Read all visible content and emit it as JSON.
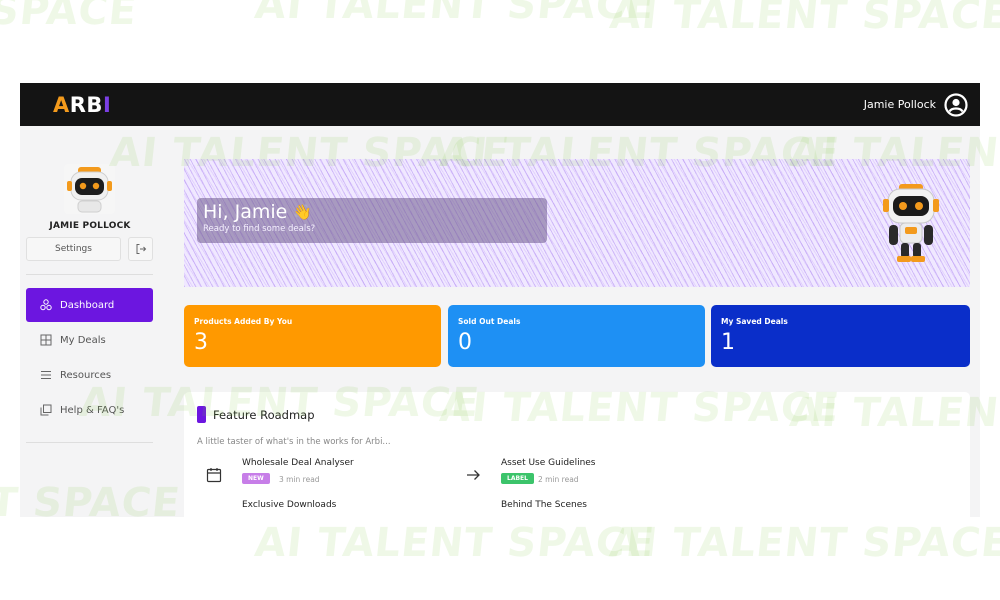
{
  "brand": {
    "logo_a": "A",
    "logo_rb": "RB",
    "logo_i": "I"
  },
  "header": {
    "user_name": "Jamie Pollock"
  },
  "profile": {
    "name": "JAMIE POLLOCK",
    "settings_label": "Settings"
  },
  "nav": [
    {
      "label": "Dashboard",
      "icon": "dashboard-icon",
      "active": true
    },
    {
      "label": "My Deals",
      "icon": "deals-icon",
      "active": false
    },
    {
      "label": "Resources",
      "icon": "resources-icon",
      "active": false
    },
    {
      "label": "Help & FAQ's",
      "icon": "help-icon",
      "active": false
    }
  ],
  "banner": {
    "greeting": "Hi, Jamie",
    "emoji": "👋",
    "subtitle": "Ready to find some deals?"
  },
  "stats": [
    {
      "label": "Products Added By You",
      "value": "3",
      "color": "#ff9900"
    },
    {
      "label": "Sold Out Deals",
      "value": "0",
      "color": "#1e90f4"
    },
    {
      "label": "My Saved Deals",
      "value": "1",
      "color": "#0a2ec9"
    }
  ],
  "roadmap": {
    "title": "Feature Roadmap",
    "subtitle": "A little taster of what's in the works for Arbi...",
    "items": [
      {
        "title": "Wholesale Deal Analyser",
        "badge": "NEW",
        "badge_color": "#c77ee8",
        "meta": "3 min read",
        "icon": "calendar-icon"
      },
      {
        "title": "Asset Use Guidelines",
        "badge": "LABEL",
        "badge_color": "#3cc46b",
        "meta": "2 min read",
        "icon": "arrow-right-icon"
      },
      {
        "title": "Exclusive Downloads",
        "icon": "download-icon"
      },
      {
        "title": "Behind The Scenes",
        "icon": "film-icon"
      }
    ]
  },
  "watermark": {
    "text": "AI TALENT SPACE",
    "fragment_left": "SPACE",
    "fragment_bottom": "T SPACE"
  },
  "colors": {
    "accent": "#6c16e0",
    "topbar": "#141414"
  }
}
